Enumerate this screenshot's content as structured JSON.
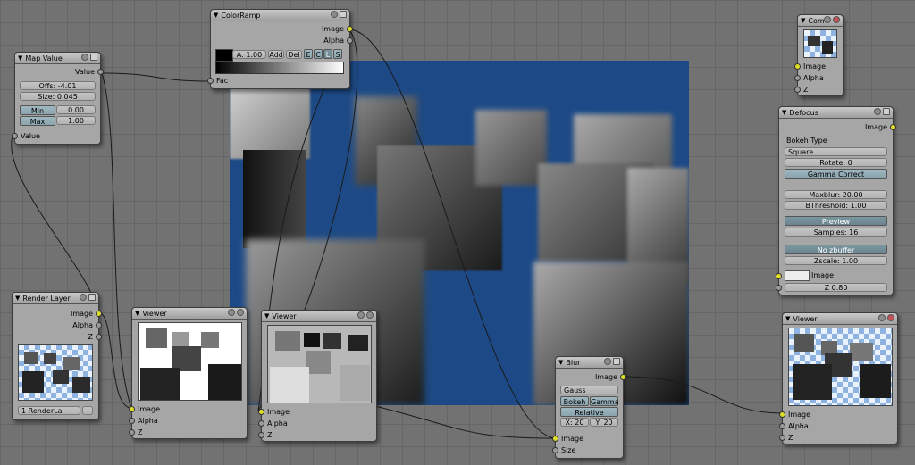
{
  "nodes": {
    "map_value": {
      "title": "Map Value",
      "out_value": "Value",
      "offs": "Offs: -4.01",
      "size": "Size: 0.045",
      "min_label": "Min",
      "min_val": "0.00",
      "max_label": "Max",
      "max_val": "1.00",
      "in_value": "Value"
    },
    "color_ramp": {
      "title": "ColorRamp",
      "out_image": "Image",
      "out_alpha": "Alpha",
      "a_val": "A: 1.00",
      "add": "Add",
      "del": "Del",
      "e": "E",
      "c": "C",
      "l": "L",
      "s": "S",
      "in_fac": "Fac"
    },
    "composite": {
      "title": "Com",
      "in_image": "Image",
      "in_alpha": "Alpha",
      "in_z": "Z"
    },
    "defocus": {
      "title": "Defocus",
      "out_image": "Image",
      "bokeh_type_label": "Bokeh Type",
      "bokeh_type": "Square",
      "rotate": "Rotate: 0",
      "gamma_correct": "Gamma Correct",
      "maxblur": "Maxblur: 20.00",
      "bthreshold": "BThreshold: 1.00",
      "preview": "Preview",
      "samples": "Samples: 16",
      "no_zbuffer": "No zbuffer",
      "zscale": "Zscale: 1.00",
      "in_image": "Image",
      "z": "Z 0.80"
    },
    "render_layer": {
      "title": "Render Layer",
      "out_image": "Image",
      "out_alpha": "Alpha",
      "out_z": "Z",
      "layer": "1 RenderLa"
    },
    "viewer1": {
      "title": "Viewer",
      "in_image": "Image",
      "in_alpha": "Alpha",
      "in_z": "Z"
    },
    "viewer2": {
      "title": "Viewer",
      "in_image": "Image",
      "in_alpha": "Alpha",
      "in_z": "Z"
    },
    "blur": {
      "title": "Blur",
      "out_image": "Image",
      "filter": "Gauss",
      "bokeh": "Bokeh",
      "gamma": "Gamma",
      "relative": "Relative",
      "x": "X: 20",
      "y": "Y: 20",
      "in_image": "Image",
      "in_size": "Size"
    },
    "viewer3": {
      "title": "Viewer",
      "in_image": "Image",
      "in_alpha": "Alpha",
      "in_z": "Z"
    }
  },
  "colors": {
    "backdrop": "#1d4a86",
    "socket_image": "#dede2a",
    "socket_value": "#9a9a9a",
    "node_bg": "#a6a6a6",
    "grid": "#727272"
  }
}
